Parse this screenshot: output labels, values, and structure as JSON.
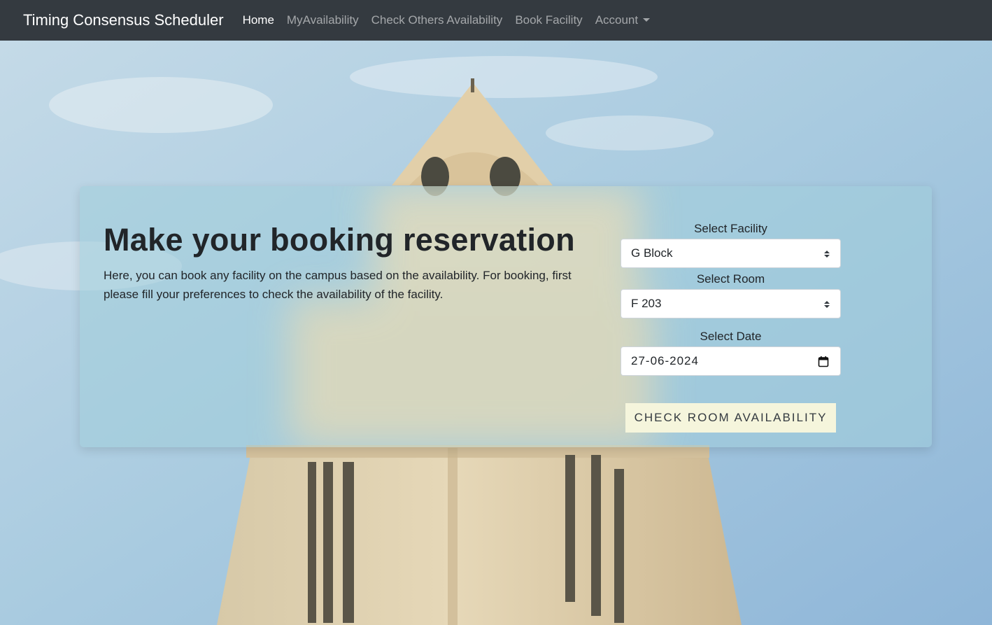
{
  "app": {
    "brand": "Timing Consensus Scheduler"
  },
  "nav": {
    "items": [
      {
        "label": "Home",
        "active": true
      },
      {
        "label": "MyAvailability",
        "active": false
      },
      {
        "label": "Check Others Availability",
        "active": false
      },
      {
        "label": "Book Facility",
        "active": false
      }
    ],
    "account": {
      "label": "Account"
    }
  },
  "booking": {
    "title": "Make your booking reservation",
    "description": "Here, you can book any facility on the campus based on the availability. For booking, first please fill your preferences to check the availability of the facility.",
    "facility": {
      "label": "Select Facility",
      "value": "G Block"
    },
    "room": {
      "label": "Select Room",
      "value": "F 203"
    },
    "date": {
      "label": "Select Date",
      "value": "27-06-2024"
    },
    "submit_label": "CHECK ROOM AVAILABILITY"
  },
  "colors": {
    "navbar": "#343a40",
    "button_bg": "#f5f5dc",
    "card_tint": "#a0cdda"
  }
}
